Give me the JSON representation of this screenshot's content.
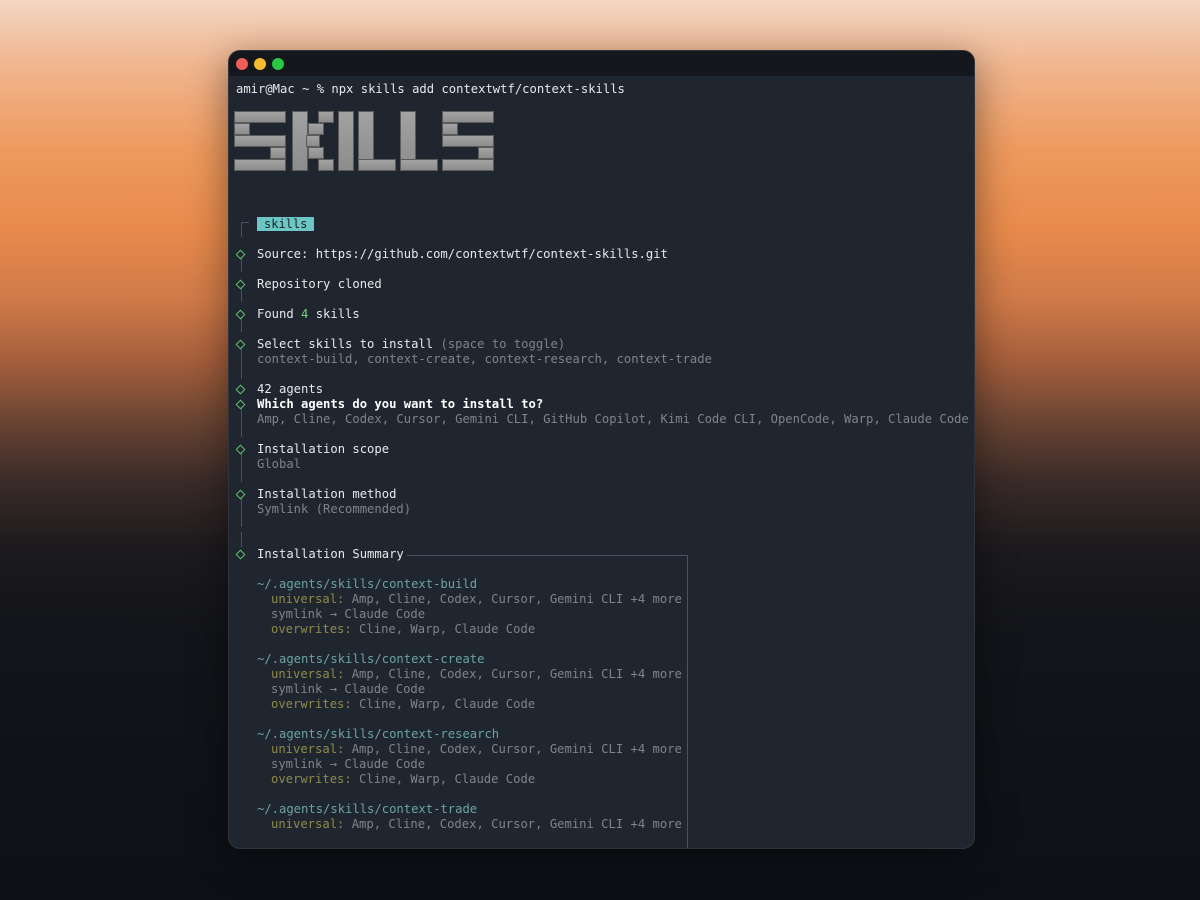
{
  "window": {
    "command": "amir@Mac ~ % npx skills add contextwtf/context-skills"
  },
  "logo": {
    "text": "SKILLS"
  },
  "session": {
    "badge": "skills",
    "source": "Source: https://github.com/contextwtf/context-skills.git",
    "cloned": "Repository cloned",
    "found_prefix": "Found ",
    "found_count": "4",
    "found_suffix": " skills",
    "select_title": "Select skills to install",
    "select_hint": "(space to toggle)",
    "select_value": "context-build, context-create, context-research, context-trade",
    "agents_count": "42 agents",
    "agents_question": "Which agents do you want to install to?",
    "agents_value": "Amp, Cline, Codex, Cursor, Gemini CLI, GitHub Copilot, Kimi Code CLI, OpenCode, Warp, Claude Code",
    "scope_title": "Installation scope",
    "scope_value": "Global",
    "method_title": "Installation method",
    "method_value": "Symlink (Recommended)",
    "summary_title": "Installation Summary"
  },
  "summary": [
    {
      "path": "~/.agents/skills/context-build",
      "universal_label": "universal:",
      "universal_value": " Amp, Cline, Codex, Cursor, Gemini CLI +4 more",
      "symlink": "symlink → Claude Code",
      "overwrites_label": "overwrites:",
      "overwrites_value": " Cline, Warp, Claude Code"
    },
    {
      "path": "~/.agents/skills/context-create",
      "universal_label": "universal:",
      "universal_value": " Amp, Cline, Codex, Cursor, Gemini CLI +4 more",
      "symlink": "symlink → Claude Code",
      "overwrites_label": "overwrites:",
      "overwrites_value": " Cline, Warp, Claude Code"
    },
    {
      "path": "~/.agents/skills/context-research",
      "universal_label": "universal:",
      "universal_value": " Amp, Cline, Codex, Cursor, Gemini CLI +4 more",
      "symlink": "symlink → Claude Code",
      "overwrites_label": "overwrites:",
      "overwrites_value": " Cline, Warp, Claude Code"
    },
    {
      "path": "~/.agents/skills/context-trade",
      "universal_label": "universal:",
      "universal_value": " Amp, Cline, Codex, Cursor, Gemini CLI +4 more"
    }
  ],
  "colors": {
    "window_bg": "#20262f",
    "badge_bg": "#6cc6c3",
    "diamond": "#5fbf6a",
    "path": "#6aa3a3",
    "label": "#8e8a4a"
  }
}
